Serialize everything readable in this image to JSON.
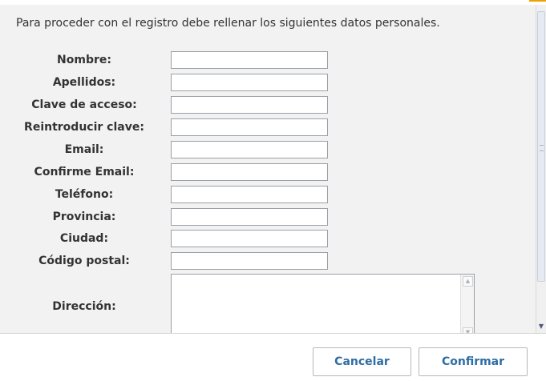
{
  "intro_text": "Para proceder con el registro debe rellenar los siguientes datos personales.",
  "fields": [
    {
      "label": "Nombre:",
      "value": ""
    },
    {
      "label": "Apellidos:",
      "value": ""
    },
    {
      "label": "Clave de acceso:",
      "value": ""
    },
    {
      "label": "Reintroducir clave:",
      "value": ""
    },
    {
      "label": "Email:",
      "value": ""
    },
    {
      "label": "Confirme Email:",
      "value": ""
    },
    {
      "label": "Teléfono:",
      "value": ""
    },
    {
      "label": "Provincia:",
      "value": ""
    },
    {
      "label": "Ciudad:",
      "value": ""
    },
    {
      "label": "Código postal:",
      "value": ""
    }
  ],
  "address": {
    "label": "Dirección:",
    "value": ""
  },
  "buttons": {
    "cancel_label": "Cancelar",
    "confirm_label": "Confirmar"
  },
  "colors": {
    "panel_background": "#f2f2f2",
    "button_text": "#2e6da4",
    "accent": "#f0a000"
  }
}
